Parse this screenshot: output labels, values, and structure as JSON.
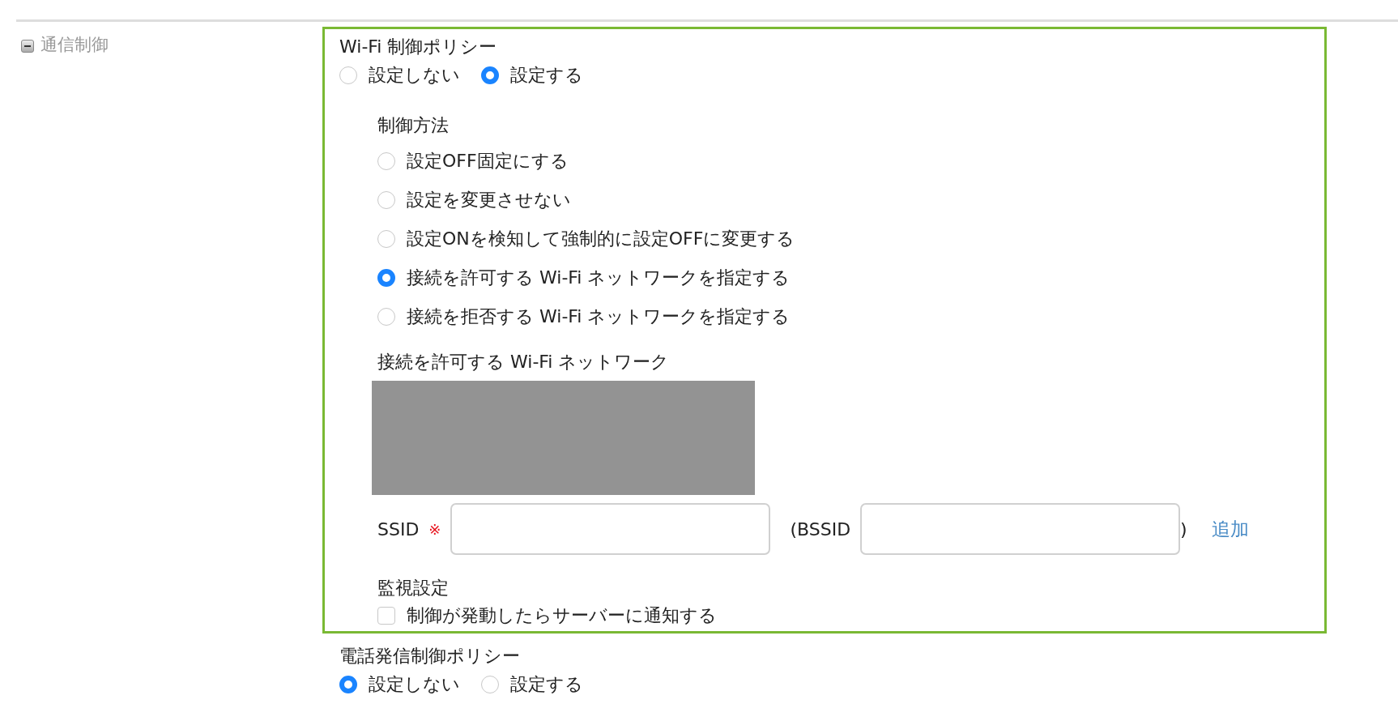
{
  "section": {
    "label": "通信制御",
    "expanded": true
  },
  "wifi_policy": {
    "title": "Wi-Fi 制御ポリシー",
    "options": [
      {
        "label": "設定しない",
        "selected": false
      },
      {
        "label": "設定する",
        "selected": true
      }
    ],
    "method": {
      "heading": "制御方法",
      "options": [
        {
          "label": "設定OFF固定にする",
          "selected": false
        },
        {
          "label": "設定を変更させない",
          "selected": false
        },
        {
          "label": "設定ONを検知して強制的に設定OFFに変更する",
          "selected": false
        },
        {
          "label": "接続を許可する Wi-Fi ネットワークを指定する",
          "selected": true
        },
        {
          "label": "接続を拒否する Wi-Fi ネットワークを指定する",
          "selected": false
        }
      ]
    },
    "network_list": {
      "heading": "接続を許可する Wi-Fi ネットワーク"
    },
    "ssid": {
      "label": "SSID",
      "required_mark": "※"
    },
    "bssid": {
      "label_open": "(BSSID",
      "label_close": ")"
    },
    "add_link": "追加",
    "monitoring": {
      "heading": "監視設定",
      "checkbox": {
        "label": "制御が発動したらサーバーに通知する",
        "checked": false
      }
    }
  },
  "call_policy": {
    "title": "電話発信制御ポリシー",
    "options": [
      {
        "label": "設定しない",
        "selected": true
      },
      {
        "label": "設定する",
        "selected": false
      }
    ]
  }
}
